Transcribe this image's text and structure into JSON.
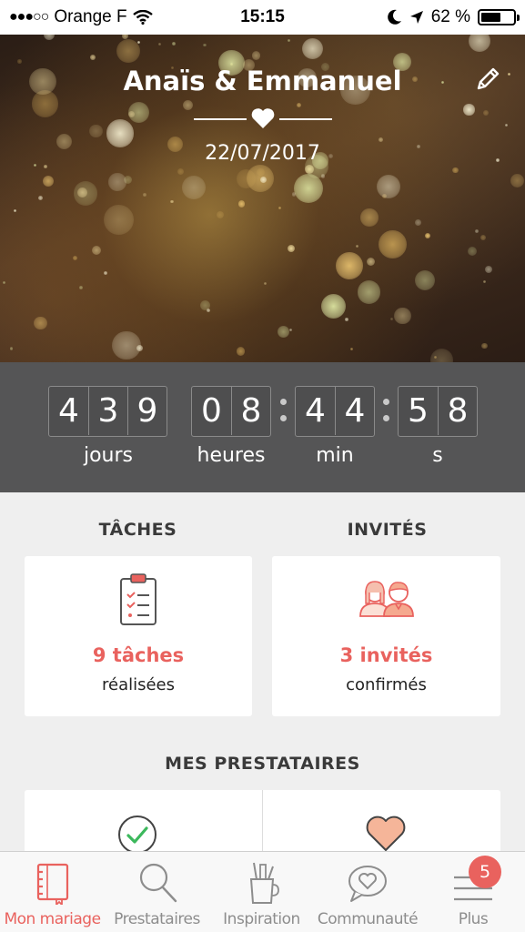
{
  "status_bar": {
    "signal_dots": "●●●○○",
    "carrier": "Orange F",
    "time": "15:15",
    "battery_percent": "62 %",
    "battery_level": 0.62
  },
  "hero": {
    "couple": "Anaïs & Emmanuel",
    "date": "22/07/2017"
  },
  "countdown": {
    "days_digits": [
      "4",
      "3",
      "9"
    ],
    "hours_digits": [
      "0",
      "8"
    ],
    "minutes_digits": [
      "4",
      "4"
    ],
    "seconds_digits": [
      "5",
      "8"
    ],
    "units": {
      "days": "jours",
      "hours": "heures",
      "minutes": "min",
      "seconds": "s"
    }
  },
  "tasks": {
    "title": "TÂCHES",
    "count": "9 tâches",
    "label": "réalisées"
  },
  "guests": {
    "title": "INVITÉS",
    "count": "3 invités",
    "label": "confirmés"
  },
  "vendors": {
    "title": "MES PRESTATAIRES"
  },
  "tabbar": {
    "tabs": [
      {
        "label": "Mon mariage",
        "icon": "notebook-icon",
        "active": true
      },
      {
        "label": "Prestataires",
        "icon": "search-icon",
        "active": false
      },
      {
        "label": "Inspiration",
        "icon": "pencil-cup-icon",
        "active": false
      },
      {
        "label": "Communauté",
        "icon": "chat-heart-icon",
        "active": false
      },
      {
        "label": "Plus",
        "icon": "menu-icon",
        "active": false
      }
    ],
    "badge": "5"
  },
  "colors": {
    "accent": "#e9625e",
    "countdown_bg": "#555556",
    "page_bg": "#efefef"
  }
}
